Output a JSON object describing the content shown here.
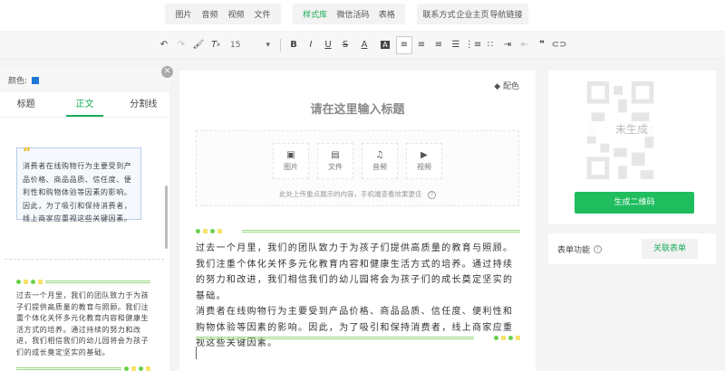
{
  "top_groups": [
    {
      "items": [
        "图片",
        "音频",
        "视频",
        "文件"
      ]
    },
    {
      "items": [
        "样式库",
        "微信活码",
        "表格"
      ],
      "active": "样式库"
    },
    {
      "items": [
        "联系方式",
        "企业主页",
        "导航链接"
      ]
    }
  ],
  "toolbar": {
    "font_size": "15",
    "bold": "B",
    "italic": "I",
    "underline": "U",
    "strike": "S",
    "font_color": "A",
    "bg_color": "A",
    "quote": "❞"
  },
  "left_panel": {
    "color_label": "颜色:",
    "color_value": "#1e78d6",
    "tabs": [
      "标题",
      "正文",
      "分割线"
    ],
    "active_tab": "正文",
    "sample1": "消费者在线购物行为主要受到产品价格、商品品质、信任度、便利性和购物体验等因素的影响。因此，为了吸引和保持消费者，线上商家应重视这些关键因素。",
    "sample2": "过去一个月里，我们的团队致力于为孩子们提供高质量的教育与照顾。我们注重个体化关怀多元化教育内容和健康生活方式的培养。通过持续的努力和改进，我们相信我们的幼儿园将会为孩子们的成长奠定坚实的基础。"
  },
  "editor": {
    "color_scheme": "配色",
    "title_placeholder": "请在这里输入标题",
    "upload_buttons": [
      "图片",
      "文件",
      "音频",
      "视频"
    ],
    "upload_hint": "此处上传重点展示的内容，手机端查看效果更佳",
    "paragraphs": [
      "过去一个月里，我们的团队致力于为孩子们提供高质量的教育与照顾。我们注重个体化关怀多元化教育内容和健康生活方式的培养。通过持续的努力和改进，我们相信我们的幼儿园将会为孩子们的成长奠定坚实的基础。",
      "消费者在线购物行为主要受到产品价格、商品品质、信任度、便利性和购物体验等因素的影响。因此，为了吸引和保持消费者，线上商家应重视这些关键因素。"
    ]
  },
  "right_panel": {
    "qr_status": "未生成",
    "generate_button": "生成二维码",
    "form_label": "表单功能",
    "link_form_button": "关联表单"
  },
  "colors": {
    "accent": "#1fbd5e",
    "deco_green": "#6ad14d",
    "deco_yellow": "#f8e16d"
  }
}
